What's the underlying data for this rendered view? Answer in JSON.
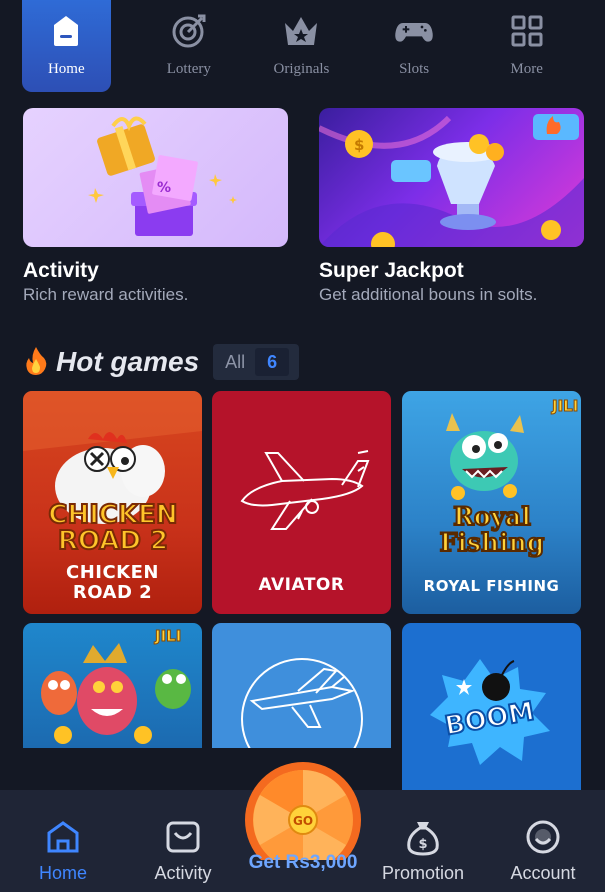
{
  "topnav": {
    "items": [
      {
        "label": "Home",
        "icon": "home-icon",
        "active": true
      },
      {
        "label": "Lottery",
        "icon": "lottery-icon"
      },
      {
        "label": "Originals",
        "icon": "crown-icon"
      },
      {
        "label": "Slots",
        "icon": "gamepad-icon"
      },
      {
        "label": "More",
        "icon": "grid-icon"
      }
    ]
  },
  "promos": [
    {
      "title": "Activity",
      "subtitle": "Rich reward activities."
    },
    {
      "title": "Super Jackpot",
      "subtitle": "Get additional bouns in solts."
    }
  ],
  "hot_games": {
    "title": "Hot games",
    "all_label": "All",
    "count": "6"
  },
  "games": [
    {
      "name": "CHICKEN\nROAD 2",
      "line1": "CHICKEN",
      "line2": "ROAD 2",
      "logo1": "CHICKEN",
      "logo2": "ROAD 2"
    },
    {
      "name": "AVIATOR"
    },
    {
      "name": "ROYAL FISHING",
      "logo1": "Royal",
      "logo2": "Fishing",
      "badge": "JILI"
    },
    {
      "badge": "JILI"
    },
    {},
    {
      "logo": "BOOM"
    }
  ],
  "bottomnav": {
    "items": [
      {
        "label": "Home",
        "icon": "home-icon",
        "active": true
      },
      {
        "label": "Activity",
        "icon": "gift-icon"
      },
      {
        "label": "Promotion",
        "icon": "money-bag-icon"
      },
      {
        "label": "Account",
        "icon": "account-icon"
      }
    ],
    "wheel_label": "Get Rs3,000",
    "wheel_center": "GO"
  },
  "colors": {
    "background": "#141824",
    "accent": "#3f86ff",
    "nav_active": "#2f6bd6"
  }
}
